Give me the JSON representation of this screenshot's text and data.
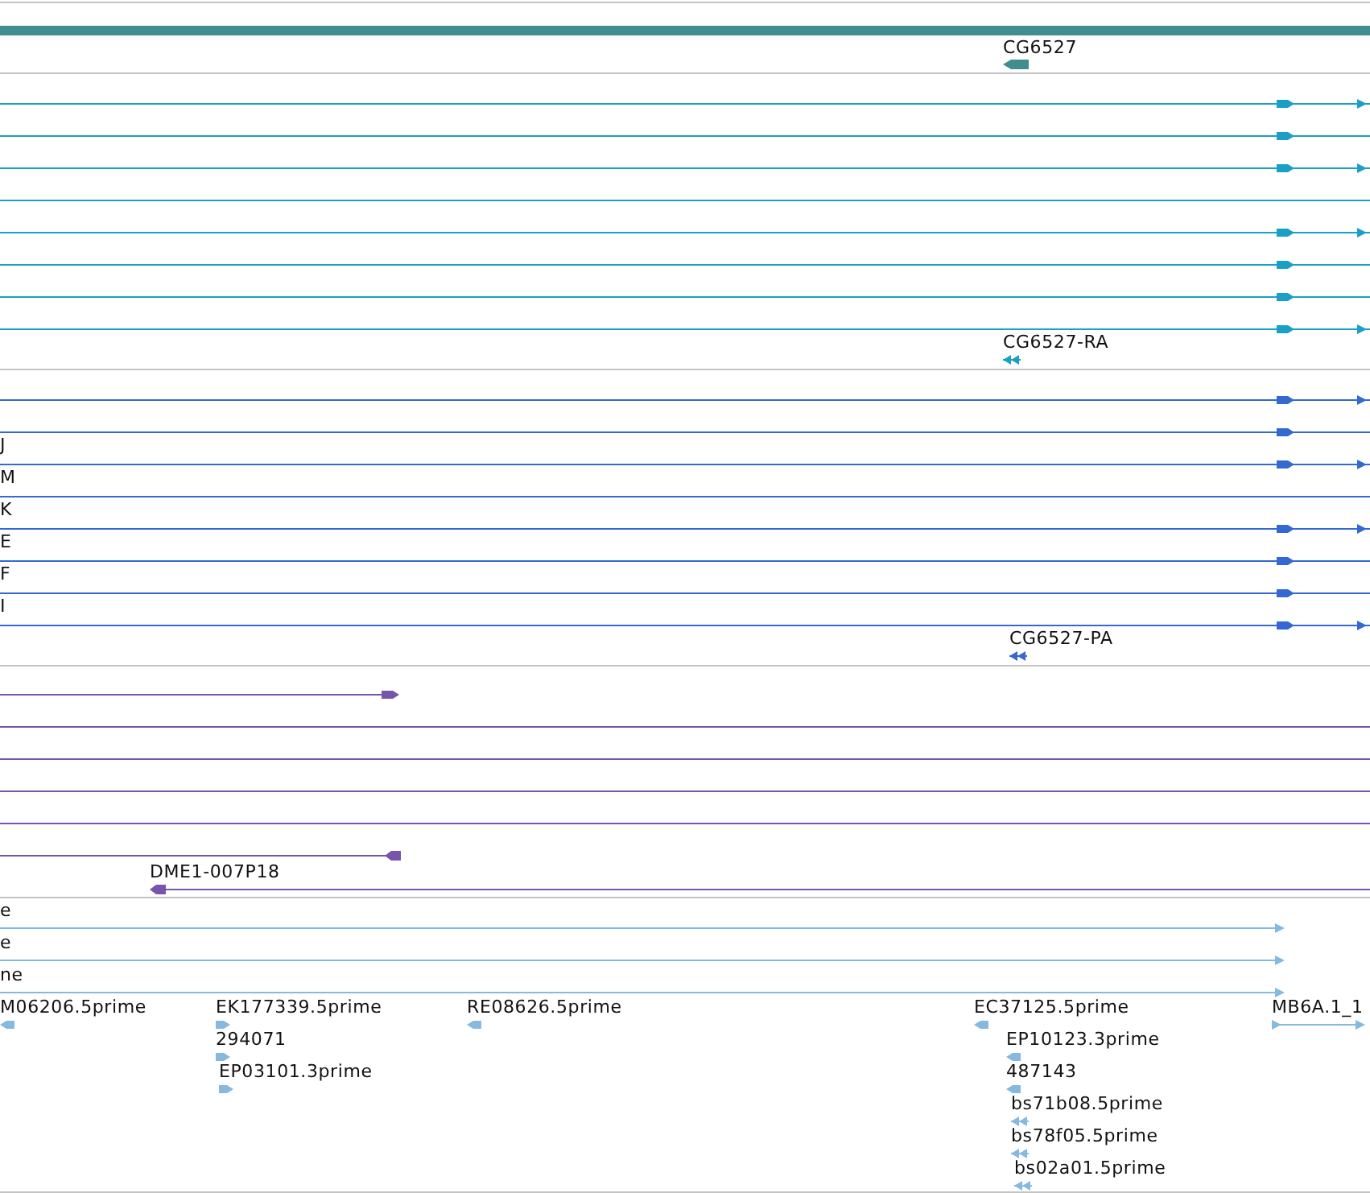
{
  "tracks": [
    {
      "kind": "gene",
      "color": "#418e90",
      "labels": [
        "CG6527"
      ]
    },
    {
      "kind": "transcripts",
      "color": "#1aa0c4",
      "labels": [
        "CG6527-RA"
      ]
    },
    {
      "kind": "proteins",
      "color": "#3369d0",
      "side_labels": [
        "J",
        "M",
        "K",
        "E",
        "F",
        "I"
      ],
      "labels": [
        "CG6527-PA"
      ]
    },
    {
      "kind": "clones",
      "color": "#7755aa",
      "labels": [
        "DME1-007P18"
      ]
    },
    {
      "kind": "ests",
      "color": "#85b9df",
      "side_labels": [
        "e",
        "e",
        "ne"
      ],
      "labels": [
        "M06206.5prime",
        "EK177339.5prime",
        "294071",
        "EP03101.3prime",
        "RE08626.5prime",
        "EC37125.5prime",
        "EP10123.3prime",
        "487143",
        "bs71b08.5prime",
        "bs78f05.5prime",
        "bs02a01.5prime",
        "MB6A.1_1"
      ]
    }
  ]
}
